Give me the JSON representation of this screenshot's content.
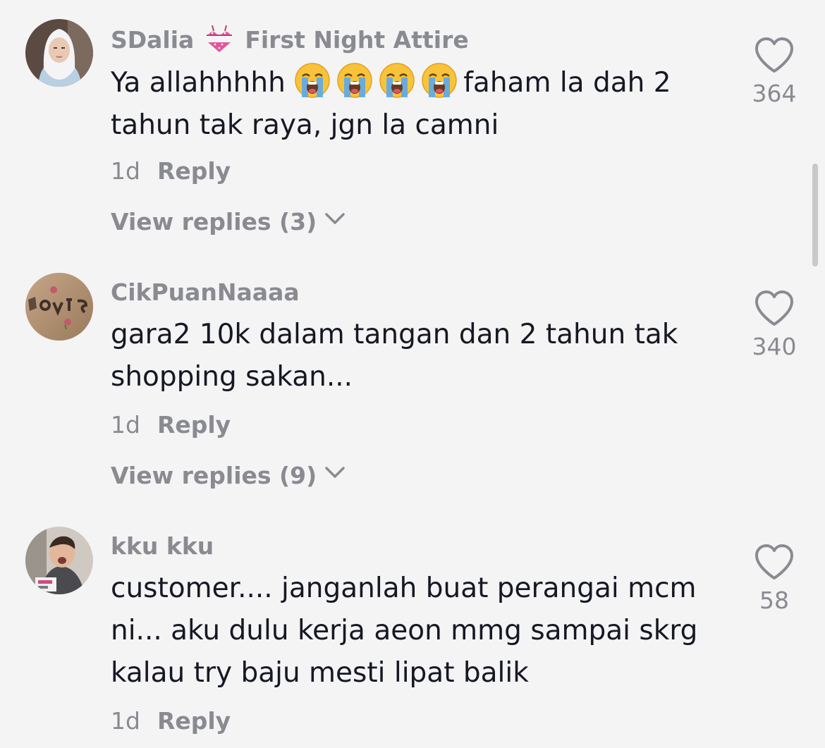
{
  "comments": [
    {
      "username": "SDalia",
      "flair_icon": "bikini-icon",
      "flair_text": "First Night Attire",
      "text_before_emoji": "Ya allahhhhh ",
      "emoji": "loudly-crying-face-emoji",
      "emoji_count": 4,
      "text_after_emoji": "faham la dah 2 tahun tak raya, jgn la camni",
      "time": "1d",
      "reply_label": "Reply",
      "view_replies": "View replies (3)",
      "likes": "364"
    },
    {
      "username": "CikPuanNaaaa",
      "text": "gara2 10k dalam tangan dan 2 tahun tak shopping sakan...",
      "time": "1d",
      "reply_label": "Reply",
      "view_replies": "View replies (9)",
      "likes": "340"
    },
    {
      "username": "kku kku",
      "text": "customer.... janganlah buat perangai mcm ni... aku dulu kerja aeon mmg sampai skrg kalau try baju mesti lipat balik",
      "time": "1d",
      "reply_label": "Reply",
      "likes": "58"
    }
  ],
  "icons": {
    "like": "heart-outline-icon",
    "expand": "chevron-down-icon"
  },
  "colors": {
    "background": "#f4f4f5",
    "text_primary": "#161823",
    "text_secondary": "#8a8b91"
  }
}
